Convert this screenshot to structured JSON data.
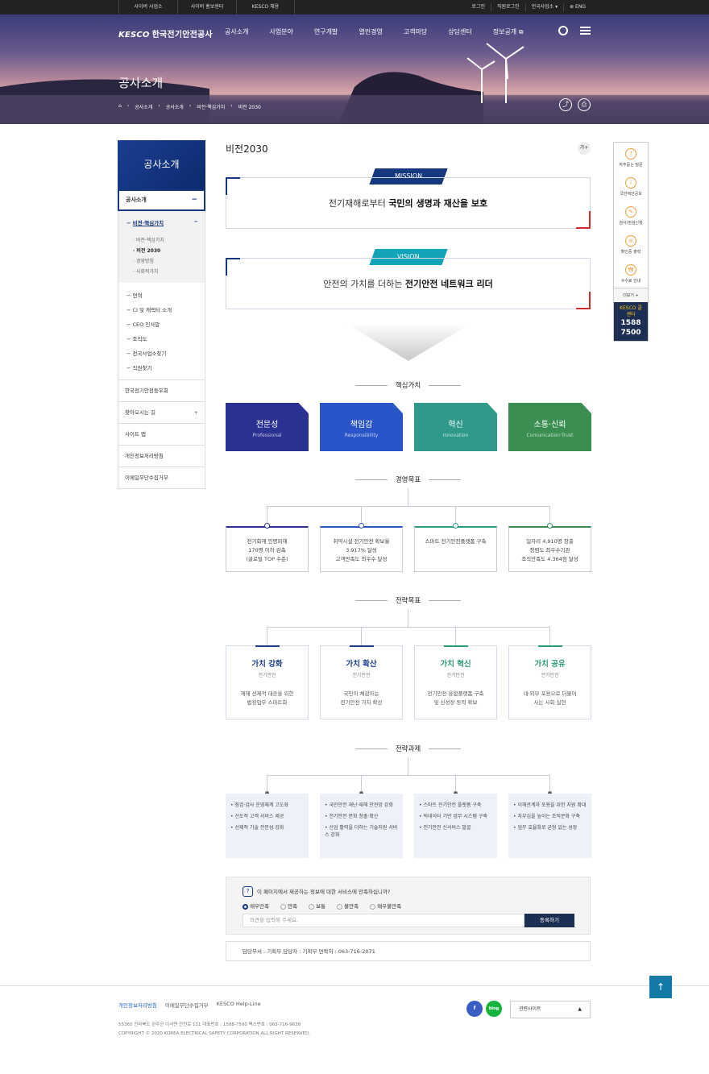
{
  "topbar": {
    "left": [
      "사이버 사업소",
      "사이버 홍보센터",
      "KESCO 채용"
    ],
    "right": [
      "로그인",
      "직원로그인",
      "전국사업소 ▾",
      "⊕ ENG"
    ]
  },
  "header": {
    "logo_mark": "KESCO",
    "logo_text": "한국전기안전공사",
    "menu": [
      "공사소개",
      "사업분야",
      "연구개발",
      "열린경영",
      "고객마당",
      "상담센터",
      "정보공개 ⧉"
    ]
  },
  "hero": {
    "title": "공사소개",
    "breadcrumb": [
      "⌂",
      "공사소개",
      "공사소개",
      "비전·핵심가치",
      "비전 2030"
    ]
  },
  "lnb": {
    "head": "공사소개",
    "selected": "공사소개",
    "active": "비전·핵심가치",
    "subs": [
      "비전·핵심가치",
      "비전 2030",
      "경영방침",
      "사회적가치"
    ],
    "group": [
      "연혁",
      "CI 및 캐릭터 소개",
      "CEO 인사말",
      "조직도",
      "전국사업소찾기",
      "직원찾기"
    ],
    "items": [
      "한국전기안전동우회",
      "찾아오시는 길",
      "사이트 맵",
      "개인정보처리방침",
      "이메일무단수집거부"
    ]
  },
  "content": {
    "title": "비전2030",
    "font_btn": "가+"
  },
  "mission": {
    "tag": "MISSION",
    "text_pre": "전기재해로부터 ",
    "text_bold": "국민의 생명과 재산을 보호"
  },
  "vision": {
    "tag": "VISION",
    "text_pre": "안전의 가치를 더하는 ",
    "text_bold": "전기안전 네트워크 리더"
  },
  "core": {
    "heading": "핵심가치",
    "items": [
      {
        "ko": "전문성",
        "en": "Professional",
        "color": "#2b3190"
      },
      {
        "ko": "책임감",
        "en": "Responsibility",
        "color": "#2a55c8"
      },
      {
        "ko": "혁신",
        "en": "Innovation",
        "color": "#2f9a8a"
      },
      {
        "ko": "소통·신뢰",
        "en": "Comunication·Trust",
        "color": "#3a8e52"
      }
    ]
  },
  "goals": {
    "heading": "경영목표",
    "items": [
      [
        "전기화재 인명피해",
        "170명 이하 감축",
        "(글로벌 TOP 수준)"
      ],
      [
        "취약시설 전기안전 확보율",
        "3.917% 달성",
        "고객만족도 최우수 달성"
      ],
      [
        "스마트 전기안전플랫폼 구축"
      ],
      [
        "일자리 4,910명 창출",
        "청렴도 최우수기관",
        "조직만족도 4.364점 달성"
      ]
    ]
  },
  "strategy": {
    "heading": "전략목표",
    "items": [
      {
        "title": "가치 강화",
        "sub": "전기안전",
        "desc": [
          "재해 선제적 대응을 위한",
          "법정업무 스마트화"
        ],
        "color": "#1c3c8c"
      },
      {
        "title": "가치 확산",
        "sub": "전기안전",
        "desc": [
          "국민이 체감하는",
          "전기안전 가치 확산"
        ],
        "color": "#1c3c8c"
      },
      {
        "title": "가치 혁신",
        "sub": "전기안전",
        "desc": [
          "전기안전 융합플랫폼 구축",
          "및 신성장 동력 확보"
        ],
        "color": "#2a9a73"
      },
      {
        "title": "가치 공유",
        "sub": "전기안전",
        "desc": [
          "내·외부 포용으로 더불어",
          "사는 사회 실현"
        ],
        "color": "#2a9a73"
      }
    ]
  },
  "tasks": {
    "heading": "전략과제",
    "items": [
      [
        "점검·검사 운영체계 고도화",
        "선도적 고객 서비스 제공",
        "선제적 기술 전문성 강화"
      ],
      [
        "국민안전 재난·재해 안전망 강화",
        "전기안전 문화 창출·확산",
        "산업 활력을 더하는 기술지원 서비스 강화"
      ],
      [
        "스마트 전기안전 플랫폼 구축",
        "빅데이터 기반 업무 시스템 구축",
        "전기안전 신서비스 발굴"
      ],
      [
        "이해관계자 포용을 위한 지원 확대",
        "자부심을 높이는 조직문화 구축",
        "업무 효율화로 균형 있는 성장"
      ]
    ]
  },
  "survey": {
    "question": "이 페이지에서 제공하는 정보에 대한 서비스에 만족하십니까?",
    "options": [
      "매우만족",
      "만족",
      "보통",
      "불만족",
      "매우불만족"
    ],
    "placeholder": "의견을 입력해 주세요.",
    "submit": "등록하기"
  },
  "charge": {
    "text": "담당부서 : 기획부     담당자 : 기획부     연락처 : 063-716-2071"
  },
  "quick": {
    "items": [
      "자주묻는 질문",
      "국민제안공모",
      "검사/점검신청",
      "확인증 출력",
      "수수료 안내"
    ],
    "more": "더보기 +",
    "call_title": "KESCO 콜센터",
    "call_num": "1588 7500"
  },
  "footer": {
    "links": [
      "개인정보처리방침",
      "이메일무단수집거부",
      "KESCO Help-Line"
    ],
    "addr": "55365 전라북도 완주군 이서면 안전로 111     대표번호 : 1588-7500     팩스번호 : 063-716-9638",
    "copy": "COPYRIGHT © 2020 KOREA ELECTRICAL SAFETY CORPORATION ALL RIGHT RESERVED.",
    "family": "관련사이트",
    "fb": "f",
    "blog": "blog",
    "top": "↑"
  }
}
